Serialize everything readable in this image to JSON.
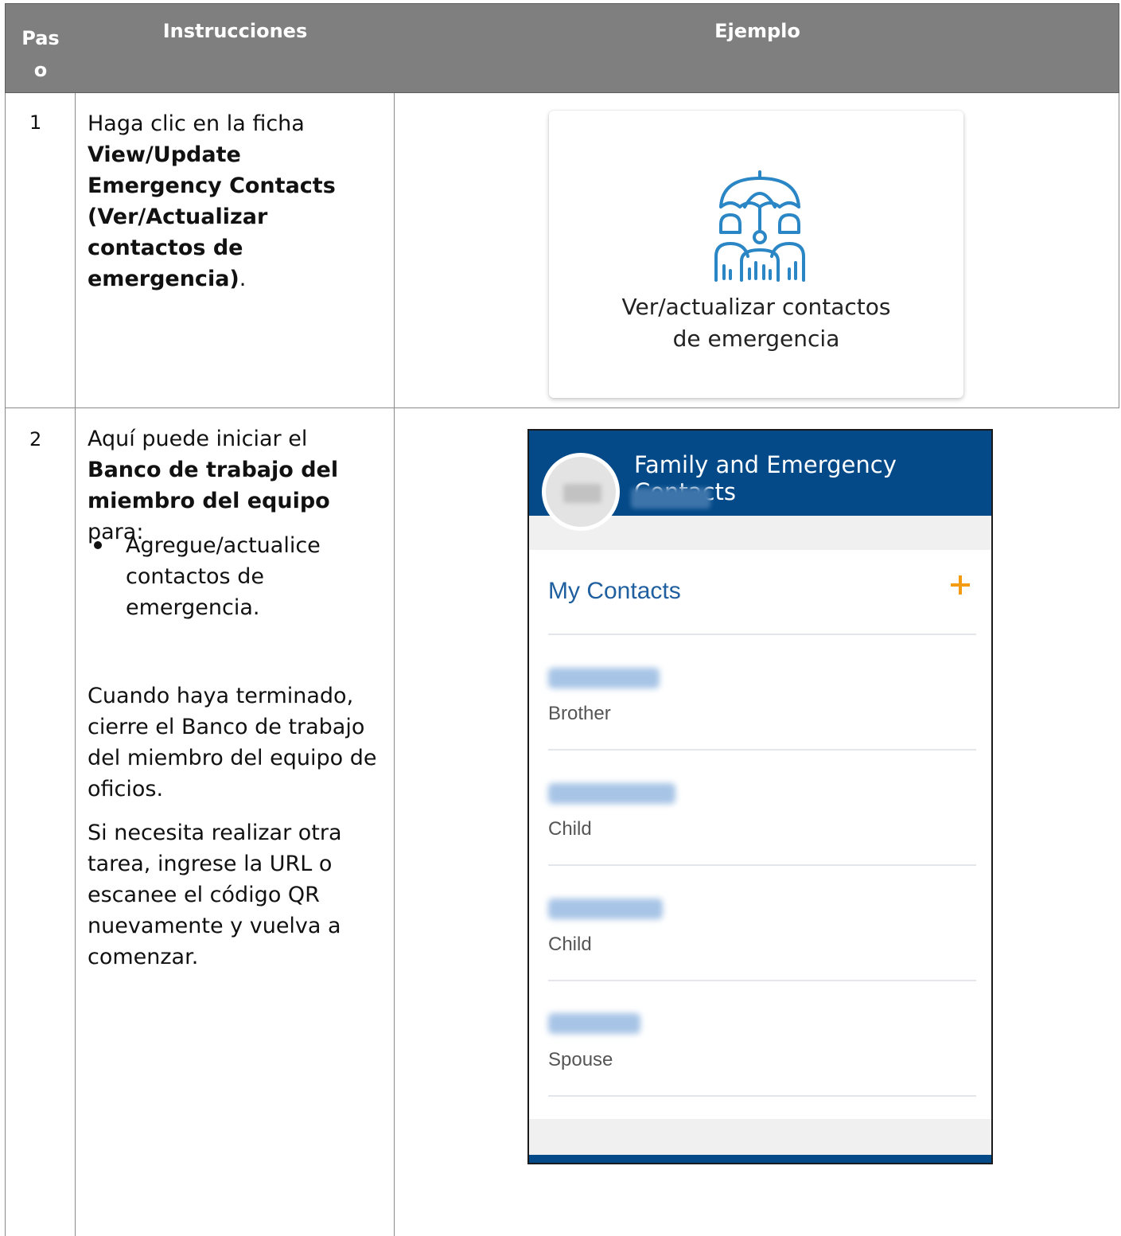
{
  "table": {
    "headers": {
      "step": "Pas\no",
      "instructions": "Instrucciones",
      "example": "Ejemplo"
    },
    "rows": [
      {
        "step": "1",
        "text_pre": "Haga clic en la ficha ",
        "text_bold": "View/Update Emergency Contacts (Ver/Actualizar contactos de emergencia)",
        "text_post": "."
      },
      {
        "step": "2",
        "text_pre": "Aquí puede iniciar el ",
        "text_bold": "Banco de trabajo del miembro del equipo",
        "text_post": " para:",
        "bullet": "Agregue/actualice contactos de emergencia.",
        "para2": "Cuando haya terminado, cierre el Banco de trabajo del miembro del equipo de oficios.",
        "para3": "Si necesita realizar otra tarea, ingrese la URL o escanee el código QR nuevamente y vuelva a comenzar."
      }
    ]
  },
  "tile": {
    "icon": "umbrella-family-icon",
    "label_line1": "Ver/actualizar contactos",
    "label_line2": "de emergencia"
  },
  "phone": {
    "header_title": "Family and Emergency Contacts",
    "section_title": "My Contacts",
    "add_icon": "plus-icon",
    "contacts": [
      {
        "relation": "Brother"
      },
      {
        "relation": "Child"
      },
      {
        "relation": "Child"
      },
      {
        "relation": "Spouse"
      }
    ],
    "colors": {
      "header": "#044a88",
      "accent": "#f39c12",
      "link": "#1f5f9f"
    }
  }
}
